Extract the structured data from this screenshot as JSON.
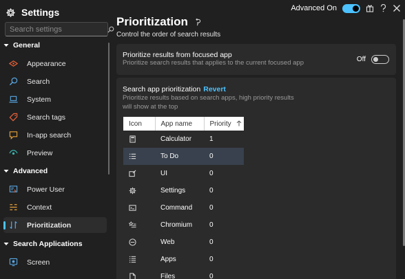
{
  "app": {
    "title": "Settings"
  },
  "search": {
    "placeholder": "Search settings"
  },
  "sidebar": {
    "groups": [
      {
        "label": "General"
      },
      {
        "label": "Advanced"
      },
      {
        "label": "Search Applications"
      }
    ],
    "items": [
      {
        "label": "Appearance",
        "icon": "palette-icon"
      },
      {
        "label": "Search",
        "icon": "search-icon"
      },
      {
        "label": "System",
        "icon": "laptop-icon"
      },
      {
        "label": "Search tags",
        "icon": "tag-icon"
      },
      {
        "label": "In-app search",
        "icon": "chat-search-icon"
      },
      {
        "label": "Preview",
        "icon": "eye-icon"
      },
      {
        "label": "Power User",
        "icon": "power-user-icon"
      },
      {
        "label": "Context",
        "icon": "context-icon"
      },
      {
        "label": "Prioritization",
        "icon": "sort-icon",
        "selected": true
      },
      {
        "label": "Screen",
        "icon": "screen-icon"
      }
    ]
  },
  "topbar": {
    "advanced_label": "Advanced On"
  },
  "page": {
    "title": "Prioritization",
    "subtitle": "Control the order of search results"
  },
  "focused_card": {
    "title": "Prioritize results from focused app",
    "description": "Prioritize search results that applies to the current focused app",
    "toggle_label": "Off"
  },
  "app_card": {
    "title": "Search app prioritization",
    "revert_label": "Revert",
    "description": "Prioritize results based on search apps, high priority results will show at the top"
  },
  "table": {
    "headers": {
      "icon": "Icon",
      "name": "App name",
      "priority": "Priority"
    },
    "rows": [
      {
        "name": "Calculator",
        "priority": "1",
        "icon": "calculator-icon"
      },
      {
        "name": "To Do",
        "priority": "0",
        "icon": "list-icon",
        "selected": true
      },
      {
        "name": "UI",
        "priority": "0",
        "icon": "ui-icon"
      },
      {
        "name": "Settings",
        "priority": "0",
        "icon": "gear-icon"
      },
      {
        "name": "Command",
        "priority": "0",
        "icon": "command-icon"
      },
      {
        "name": "Chromium",
        "priority": "0",
        "icon": "star-list-icon"
      },
      {
        "name": "Web",
        "priority": "0",
        "icon": "web-icon"
      },
      {
        "name": "Apps",
        "priority": "0",
        "icon": "apps-icon"
      },
      {
        "name": "Files",
        "priority": "0",
        "icon": "file-icon"
      }
    ]
  },
  "colors": {
    "accent": "#4cc2ff",
    "background": "#202020",
    "card": "#2b2b2b",
    "selected_row": "#38414d"
  }
}
